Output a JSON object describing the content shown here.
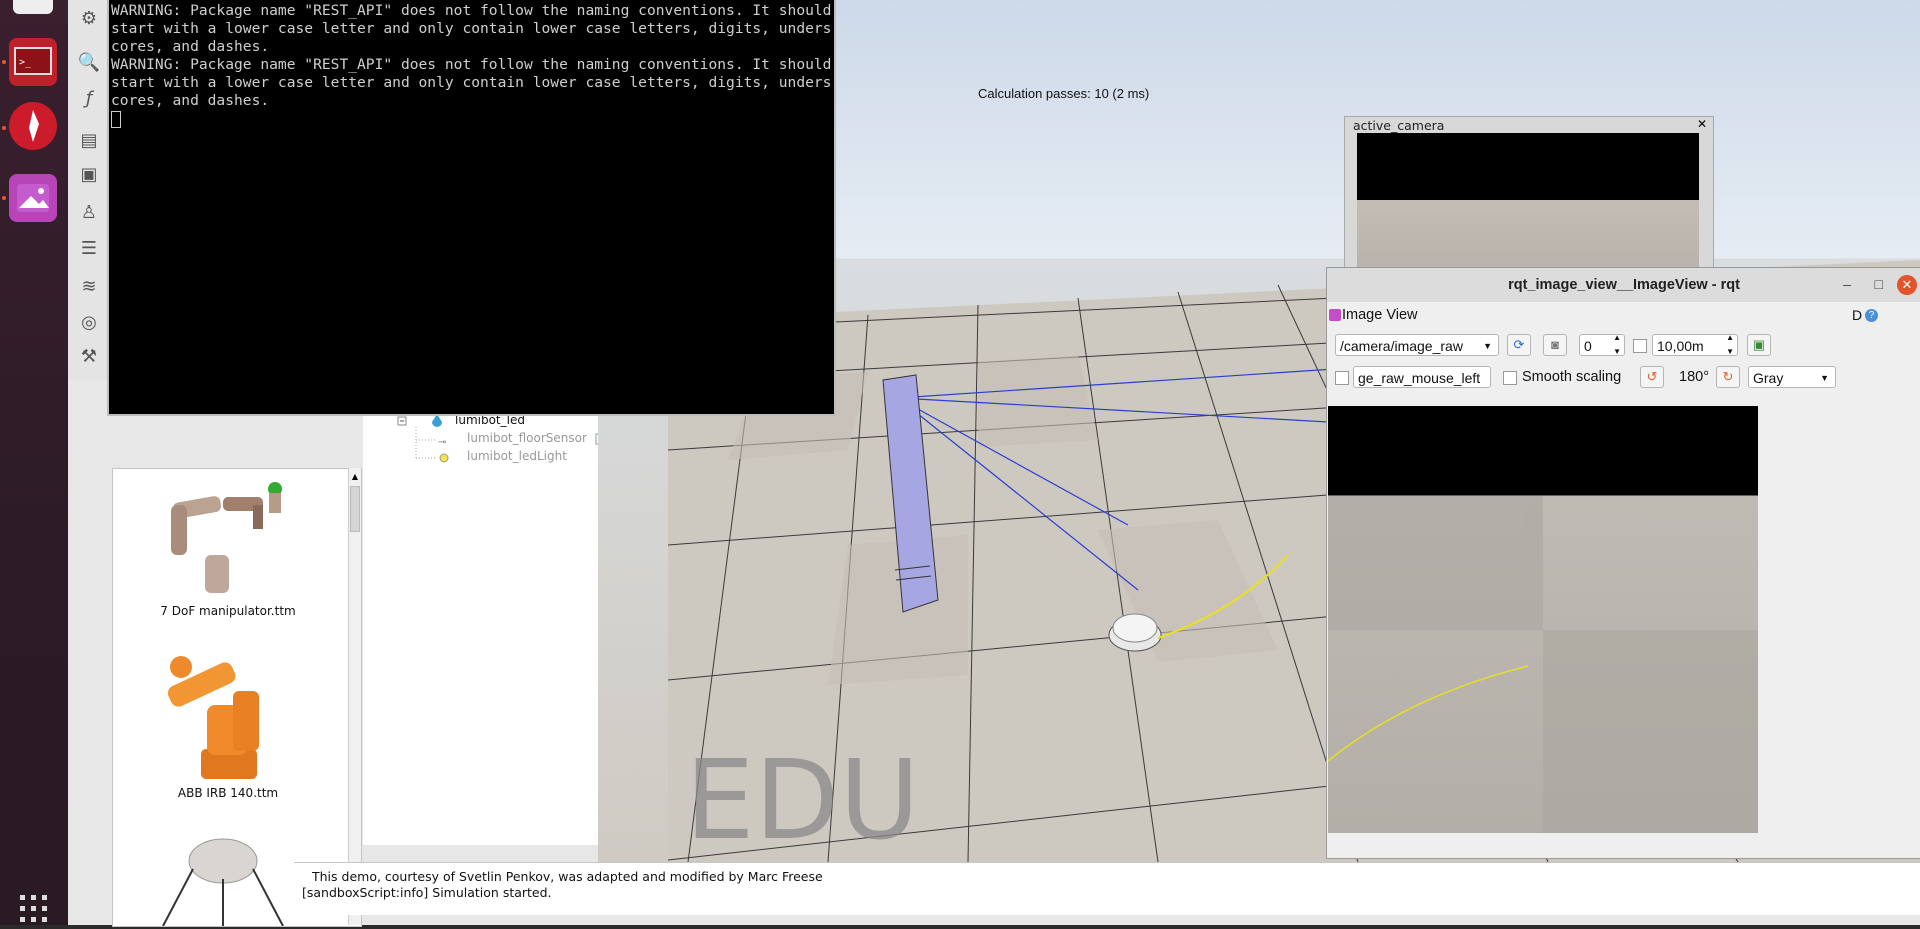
{
  "terminal": {
    "lines": "WARNING: Package name \"REST_API\" does not follow the naming conventions. It should start with a lower case letter and only contain lower case letters, digits, underscores, and dashes.\nWARNING: Package name \"REST_API\" does not follow the naming conventions. It should start with a lower case letter and only contain lower case letters, digits, underscores, and dashes."
  },
  "viewport": {
    "calc_passes": "Calculation passes: 10 (2 ms)",
    "watermark": "EDU"
  },
  "scene_tree": {
    "items": [
      "lumibot_led",
      "lumibot_floorSensor",
      "lumibot_ledLight"
    ]
  },
  "model_browser": {
    "items": [
      "7 DoF manipulator.ttm",
      "ABB IRB 140.ttm"
    ]
  },
  "status_bar": {
    "line1": "This demo, courtesy of Svetlin Penkov, was adapted and modified by Marc Freese",
    "line2": "[sandboxScript:info] Simulation started."
  },
  "active_camera": {
    "title": "active_camera"
  },
  "rqt": {
    "title": "rqt_image_view__ImageView - rqt",
    "plugin_name": "Image View",
    "plugin_right": "D",
    "topic": "/camera/image_raw",
    "spin_value": "0",
    "max_range": "10,00m",
    "mouse_topic": "ge_raw_mouse_left",
    "smooth_label": "Smooth scaling",
    "rotation": "180°",
    "colormap": "Gray"
  },
  "colors": {
    "accent": "#e2542c",
    "terminal_bg": "#000000"
  }
}
